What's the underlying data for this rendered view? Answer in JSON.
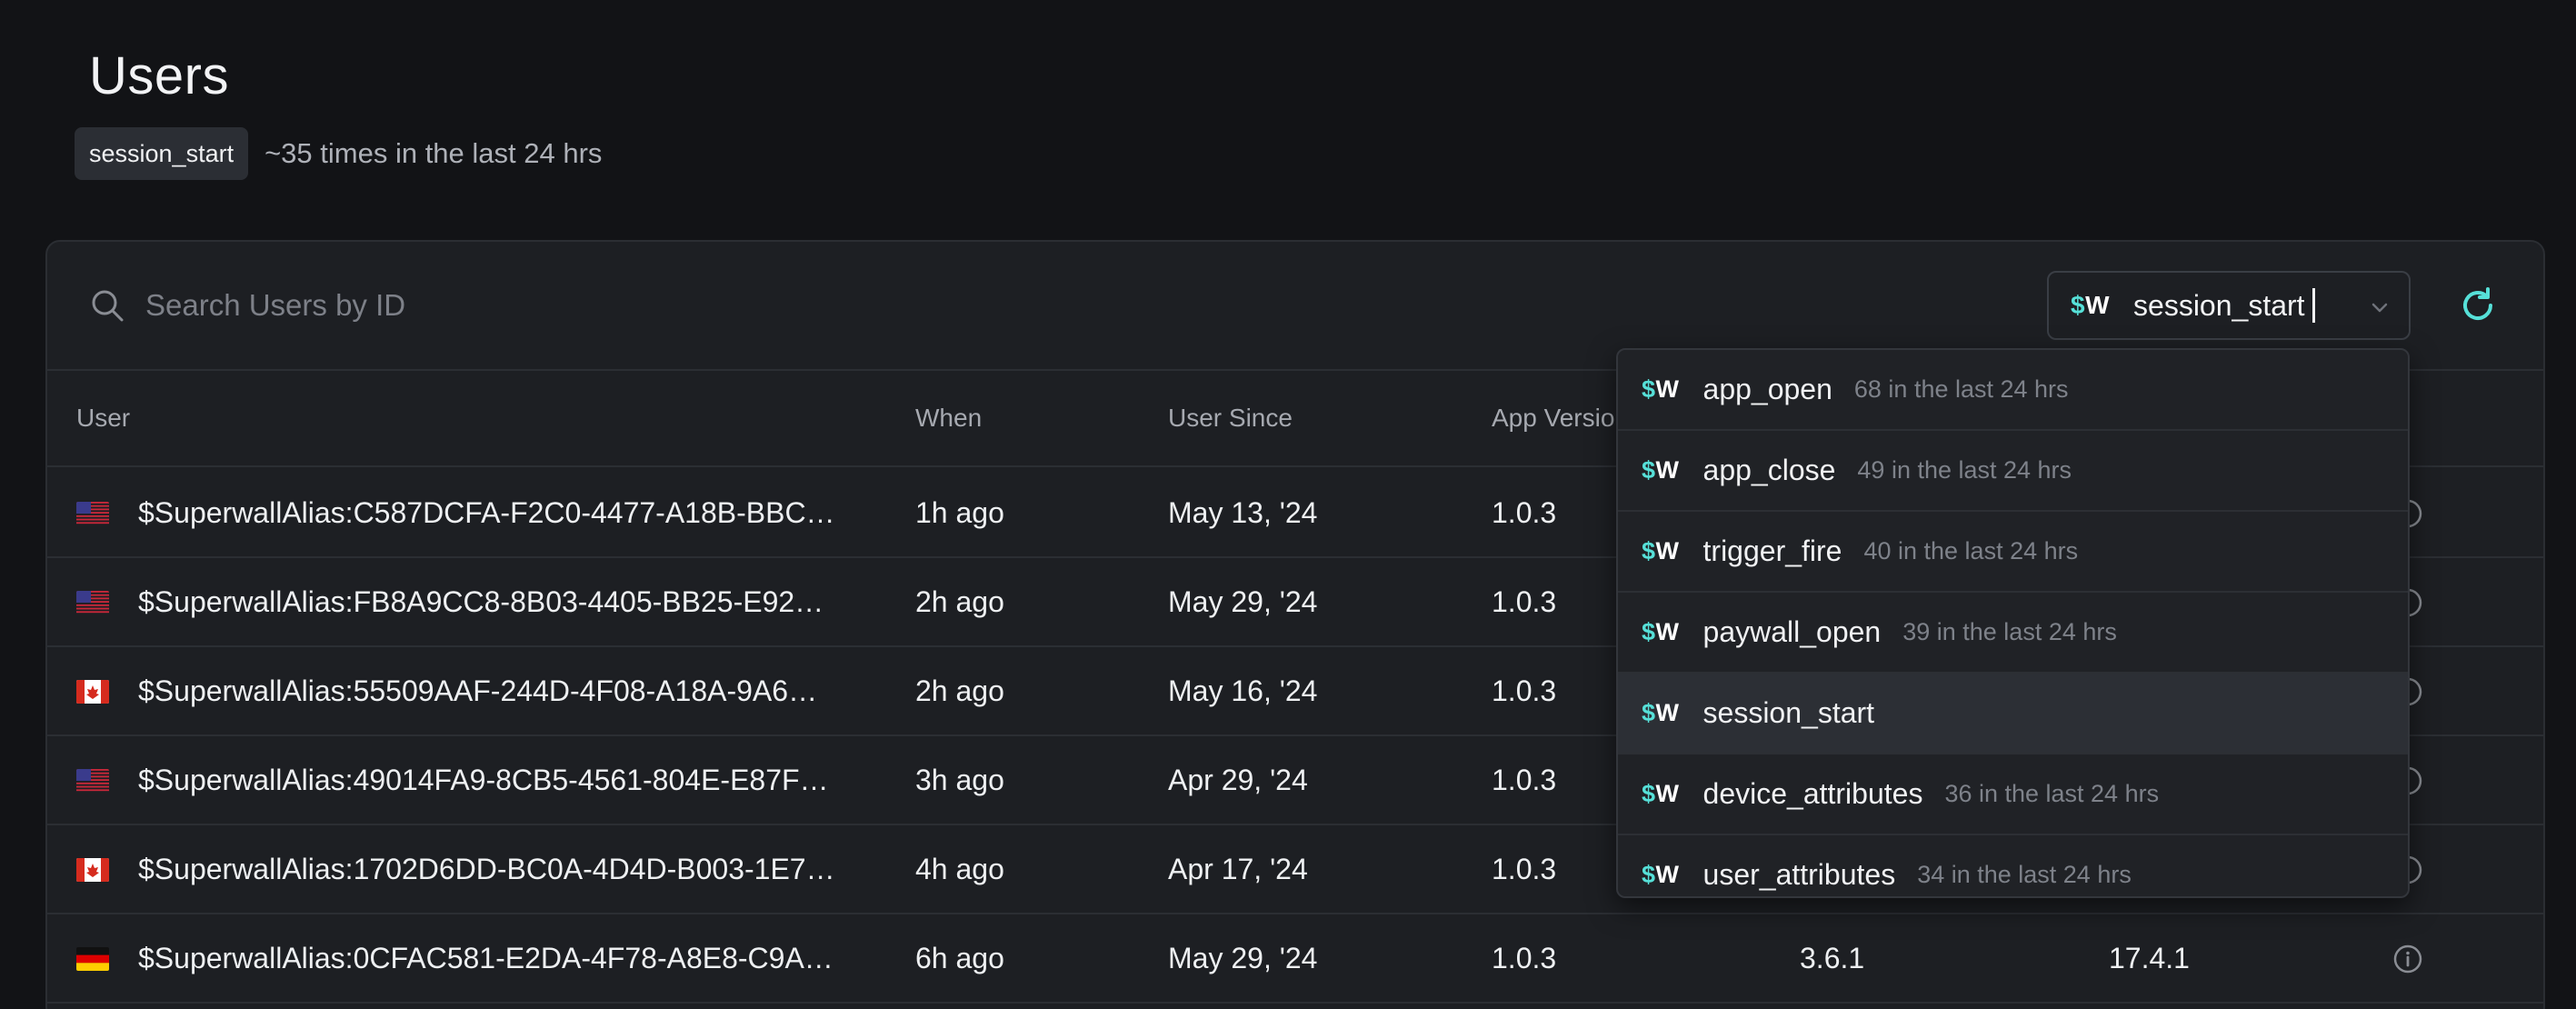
{
  "page": {
    "title": "Users",
    "event_chip": "session_start",
    "event_count": "~35 times in the last 24 hrs"
  },
  "search": {
    "placeholder": "Search Users by ID",
    "icon": "search-icon"
  },
  "event_select": {
    "logo_dollar": "$",
    "logo_letter": "W",
    "value": "session_start"
  },
  "table": {
    "headers": {
      "user": "User",
      "when": "When",
      "since": "User Since",
      "app_version": "App Version"
    },
    "rows": [
      {
        "flag": "us",
        "user": "$SuperwallAlias:C587DCFA-F2C0-4477-A18B-BBC…",
        "when": "1h ago",
        "since": "May 13, '24",
        "app_version": "1.0.3",
        "col5": "",
        "col6": ""
      },
      {
        "flag": "us",
        "user": "$SuperwallAlias:FB8A9CC8-8B03-4405-BB25-E92…",
        "when": "2h ago",
        "since": "May 29, '24",
        "app_version": "1.0.3",
        "col5": "",
        "col6": ""
      },
      {
        "flag": "ca",
        "user": "$SuperwallAlias:55509AAF-244D-4F08-A18A-9A6…",
        "when": "2h ago",
        "since": "May 16, '24",
        "app_version": "1.0.3",
        "col5": "",
        "col6": ""
      },
      {
        "flag": "us",
        "user": "$SuperwallAlias:49014FA9-8CB5-4561-804E-E87F…",
        "when": "3h ago",
        "since": "Apr 29, '24",
        "app_version": "1.0.3",
        "col5": "",
        "col6": ""
      },
      {
        "flag": "ca",
        "user": "$SuperwallAlias:1702D6DD-BC0A-4D4D-B003-1E7…",
        "when": "4h ago",
        "since": "Apr 17, '24",
        "app_version": "1.0.3",
        "col5": "",
        "col6": ""
      },
      {
        "flag": "de",
        "user": "$SuperwallAlias:0CFAC581-E2DA-4F78-A8E8-C9A…",
        "when": "6h ago",
        "since": "May 29, '24",
        "app_version": "1.0.3",
        "col5": "3.6.1",
        "col6": "17.4.1"
      }
    ]
  },
  "dropdown": {
    "options": [
      {
        "name": "app_open",
        "count": "68 in the last 24 hrs",
        "selected": false
      },
      {
        "name": "app_close",
        "count": "49 in the last 24 hrs",
        "selected": false
      },
      {
        "name": "trigger_fire",
        "count": "40 in the last 24 hrs",
        "selected": false
      },
      {
        "name": "paywall_open",
        "count": "39 in the last 24 hrs",
        "selected": false
      },
      {
        "name": "session_start",
        "count": "",
        "selected": true
      },
      {
        "name": "device_attributes",
        "count": "36 in the last 24 hrs",
        "selected": false
      },
      {
        "name": "user_attributes",
        "count": "34 in the last 24 hrs",
        "selected": false
      }
    ]
  },
  "colors": {
    "background": "#121316",
    "panel": "#1d1f23",
    "accent": "#56e0d8",
    "muted_text": "#7e828a"
  }
}
